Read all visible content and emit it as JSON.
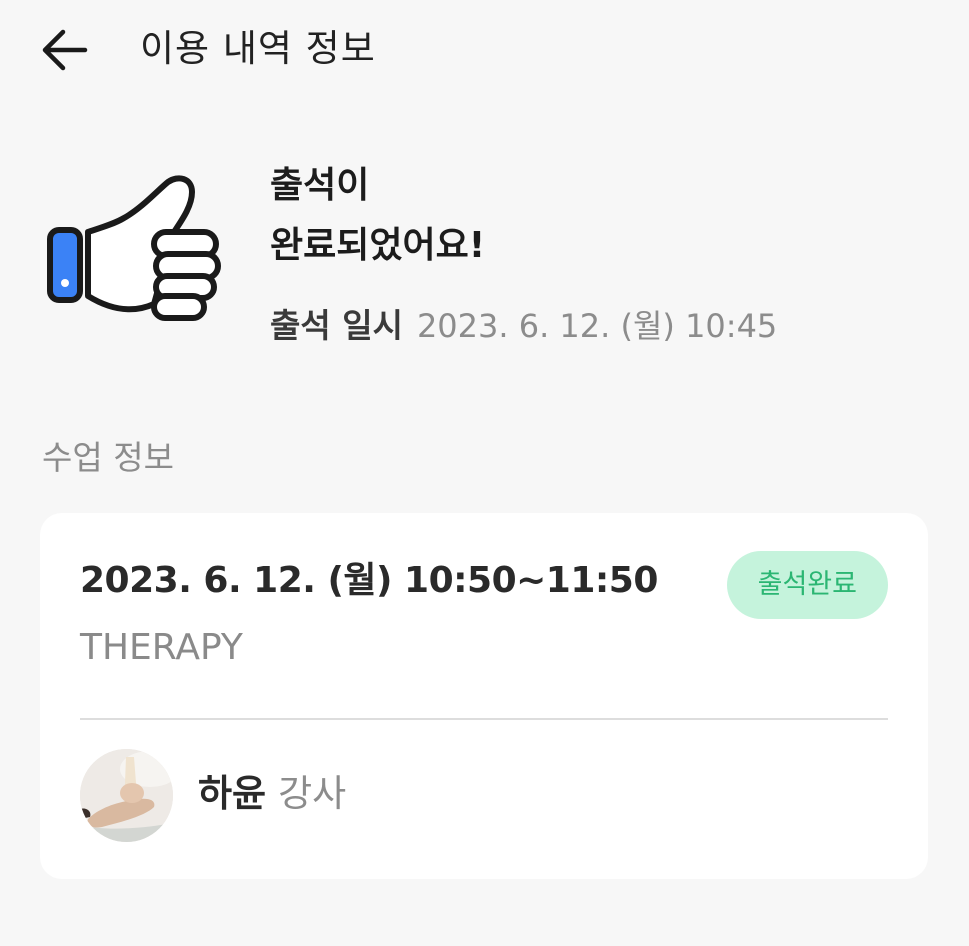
{
  "header": {
    "back_icon": "arrow-left-icon",
    "title": "이용 내역 정보"
  },
  "attendance": {
    "icon": "thumbs-up-icon",
    "title_line1": "출석이",
    "title_line2": "완료되었어요!",
    "meta_label": "출석 일시",
    "meta_value": "2023. 6. 12. (월) 10:45"
  },
  "class_info": {
    "section_label": "수업 정보",
    "datetime": "2023. 6. 12. (월) 10:50~11:50",
    "status": "출석완료",
    "name": "THERAPY",
    "instructor_name": "하윤",
    "instructor_role": "강사"
  },
  "colors": {
    "status_bg": "#c5f3dc",
    "status_text": "#2bb673",
    "cuff_blue": "#3b82f6"
  }
}
